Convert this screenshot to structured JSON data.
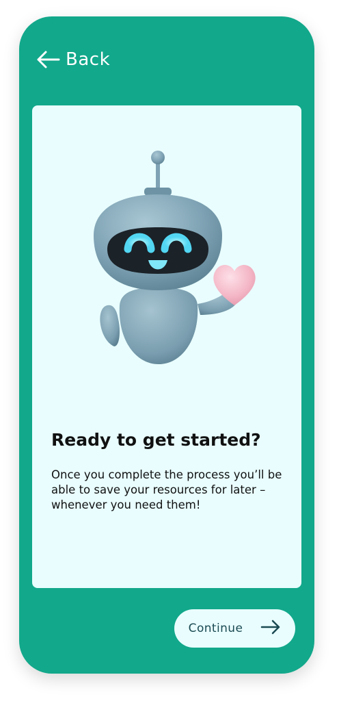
{
  "header": {
    "back_label": "Back",
    "back_icon": "arrow-left-icon"
  },
  "card": {
    "illustration": "robot-with-heart",
    "title": "Ready to get started?",
    "description": "Once you complete the process you’ll be able to save your resources for later – whenever you need them!"
  },
  "footer": {
    "continue_label": "Continue",
    "continue_icon": "arrow-right-icon"
  },
  "colors": {
    "primary": "#12a88b",
    "card_background": "#e9fdfe",
    "text": "#111111",
    "button_text": "#1a4a52"
  }
}
